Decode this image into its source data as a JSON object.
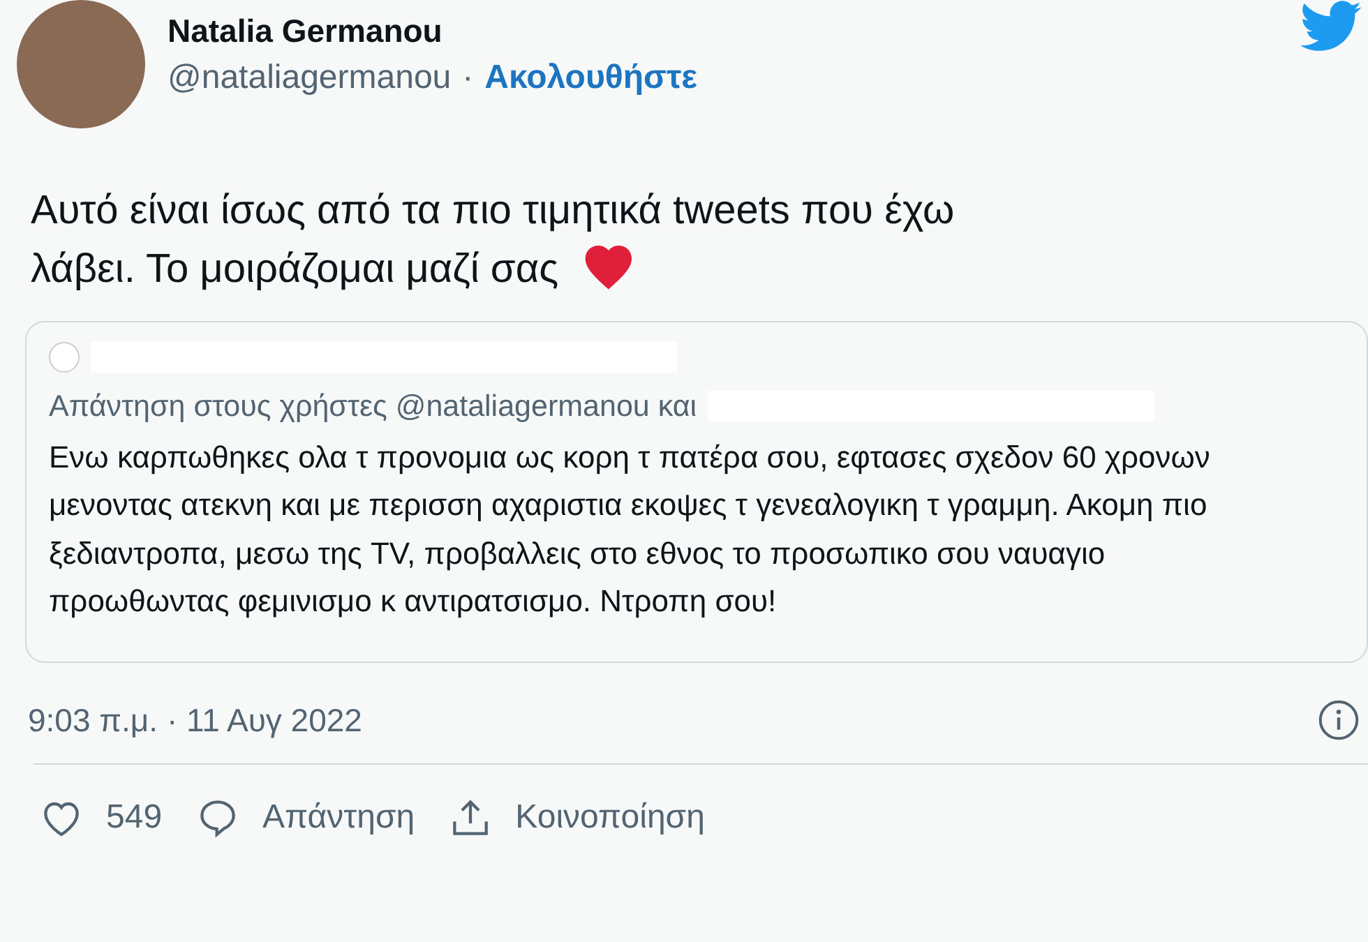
{
  "author": {
    "name": "Natalia Germanou",
    "handle": "@nataliagermanou",
    "separator": "·",
    "follow": "Ακολουθήστε"
  },
  "text_lines": [
    "Αυτό είναι ίσως από τα πιο τιμητικά tweets που έχω",
    "λάβει. Το μοιράζομαι μαζί σας"
  ],
  "quoted": {
    "reply_to": "Απάντηση στους χρήστες @nataliagermanou και",
    "text": "Ενω καρπωθηκες ολα τ προνομια ως κορη τ πατέρα σου, εφτασες σχεδον 60 χρονων μενοντας ατεκνη και με περισση αχαριστια εκοψες τ γενεαλογικη τ γραμμη. Ακομη πιο ξεδιαντροπα, μεσω της TV, προβαλλεις στο εθνος το προσωπικο σου ναυαγιο προωθωντας φεμινισμο κ αντιρατσισμο. Ντροπη σου!"
  },
  "timestamp": "9:03 π.μ. · 11 Αυγ 2022",
  "actions": [
    {
      "kind": "like",
      "label": "549"
    },
    {
      "kind": "reply",
      "label": "Απάντηση"
    },
    {
      "kind": "share",
      "label": "Κοινοποίηση"
    }
  ]
}
